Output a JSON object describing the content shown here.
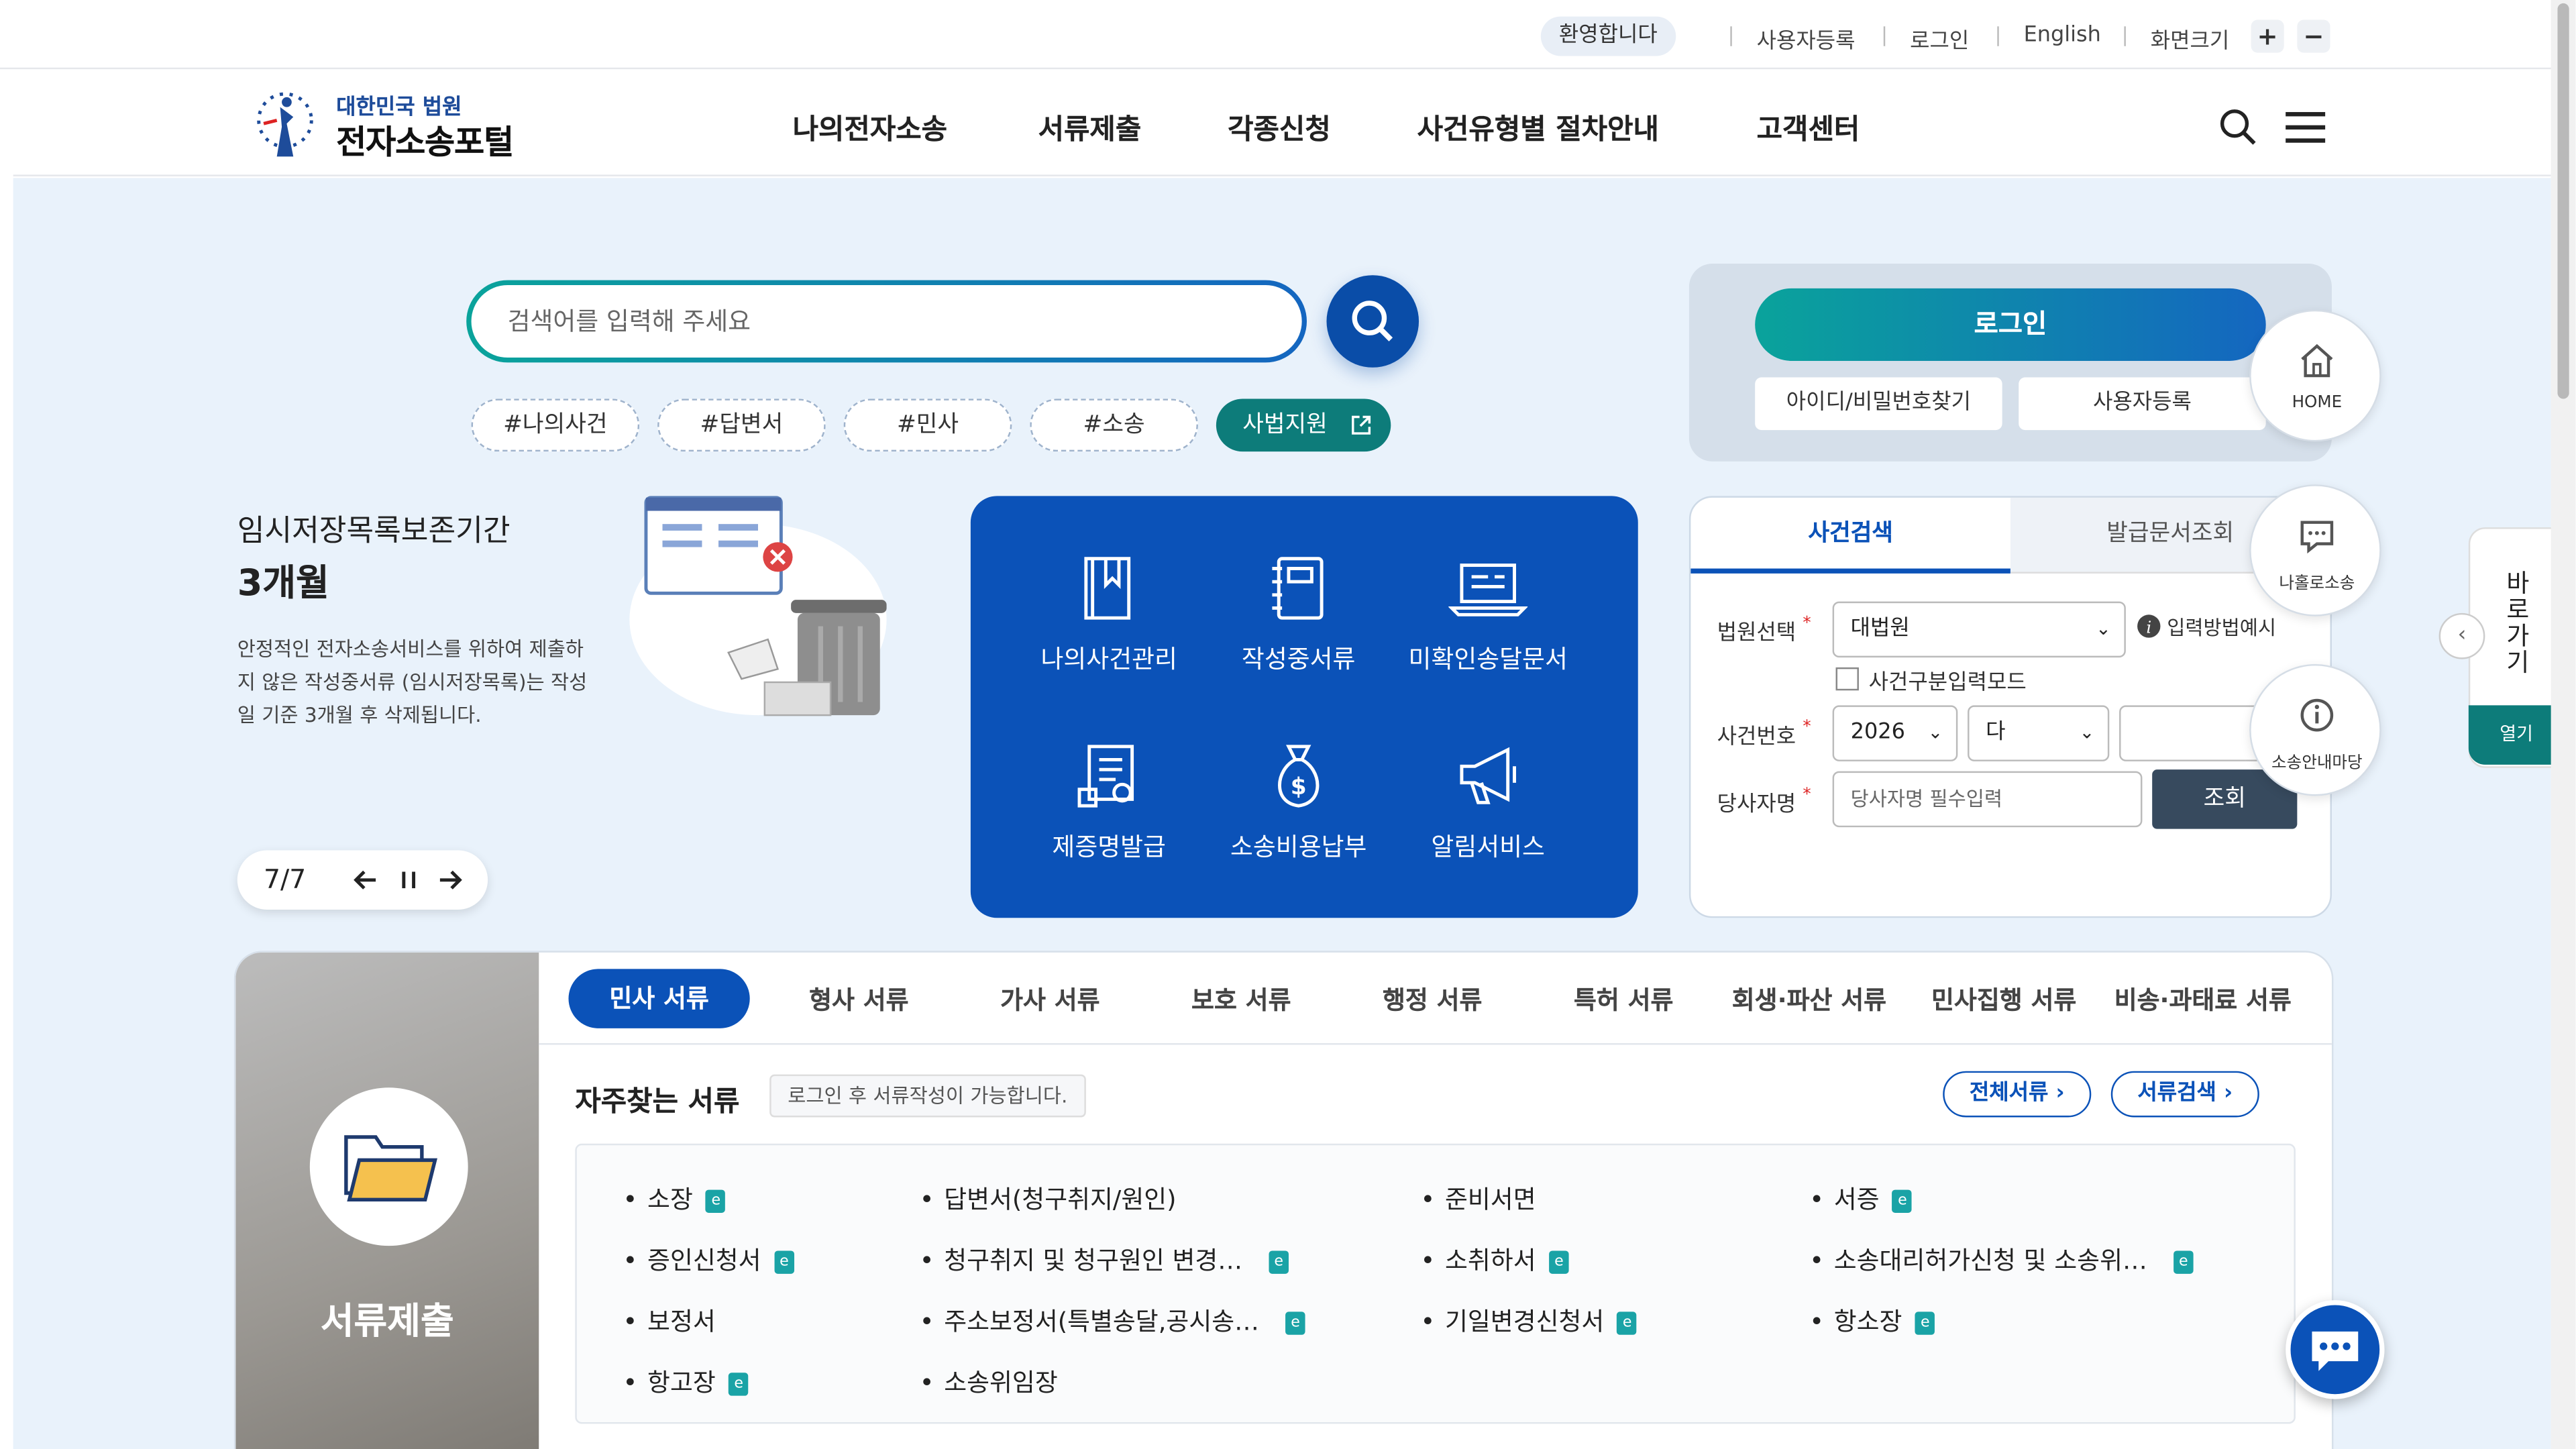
{
  "util": {
    "welcome": "환영합니다",
    "signup": "사용자등록",
    "login": "로그인",
    "english": "English",
    "font_size": "화면크기",
    "zoom_in": "+",
    "zoom_out": "−"
  },
  "header": {
    "logo_sub": "대한민국 법원",
    "logo_main": "전자소송포털",
    "nav": [
      "나의전자소송",
      "서류제출",
      "각종신청",
      "사건유형별 절차안내",
      "고객센터"
    ]
  },
  "search": {
    "placeholder": "검색어를 입력해 주세요",
    "tags": [
      "#나의사건",
      "#답변서",
      "#민사",
      "#소송"
    ],
    "judicial_support": "사법지원"
  },
  "info": {
    "title": "임시저장목록보존기간",
    "value": "3개월",
    "desc": "안정적인 전자소송서비스를 위하여 제출하지 않은 작성중서류 (임시저장목록)는 작성일 기준 3개월 후 삭제됩니다.",
    "slide_counter": "7/7"
  },
  "quick_menu": [
    "나의사건관리",
    "작성중서류",
    "미확인송달문서",
    "제증명발급",
    "소송비용납부",
    "알림서비스"
  ],
  "login_panel": {
    "login": "로그인",
    "find_id": "아이디/비밀번호찾기",
    "register": "사용자등록"
  },
  "case_search": {
    "tab_active": "사건검색",
    "tab_other": "발급문서조회",
    "court_label": "법원선택",
    "court_value": "대법원",
    "input_help": "입력방법예시",
    "mode_checkbox": "사건구분입력모드",
    "case_no_label": "사건번호",
    "year": "2026",
    "type": "다",
    "party_label": "당사자명",
    "party_placeholder": "당사자명 필수입력",
    "search_btn": "조회"
  },
  "floating": {
    "home": "HOME",
    "solo": "나홀로소송",
    "guide": "소송안내마당"
  },
  "quick_side": {
    "label": "바로가기",
    "open": "열기"
  },
  "documents": {
    "photo_label": "서류제출",
    "tabs": [
      "민사 서류",
      "형사 서류",
      "가사 서류",
      "보호 서류",
      "행정 서류",
      "특허 서류",
      "회생·파산 서류",
      "민사집행 서류",
      "비송·과태료 서류"
    ],
    "fav_title": "자주찾는 서류",
    "fav_note": "로그인 후 서류작성이 가능합니다.",
    "all_docs": "전체서류",
    "doc_search": "서류검색",
    "items": [
      "소장",
      "답변서(청구취지/원인)",
      "준비서면",
      "서증",
      "증인신청서",
      "청구취지 및 청구원인 변경…",
      "소취하서",
      "소송대리허가신청 및 소송위…",
      "보정서",
      "주소보정서(특별송달,공시송…",
      "기일변경신청서",
      "항소장",
      "항고장",
      "소송위임장"
    ]
  },
  "colors": {
    "primary_blue": "#0b52b8",
    "teal": "#0d7c7a",
    "page_bg": "#e9f2fb"
  }
}
